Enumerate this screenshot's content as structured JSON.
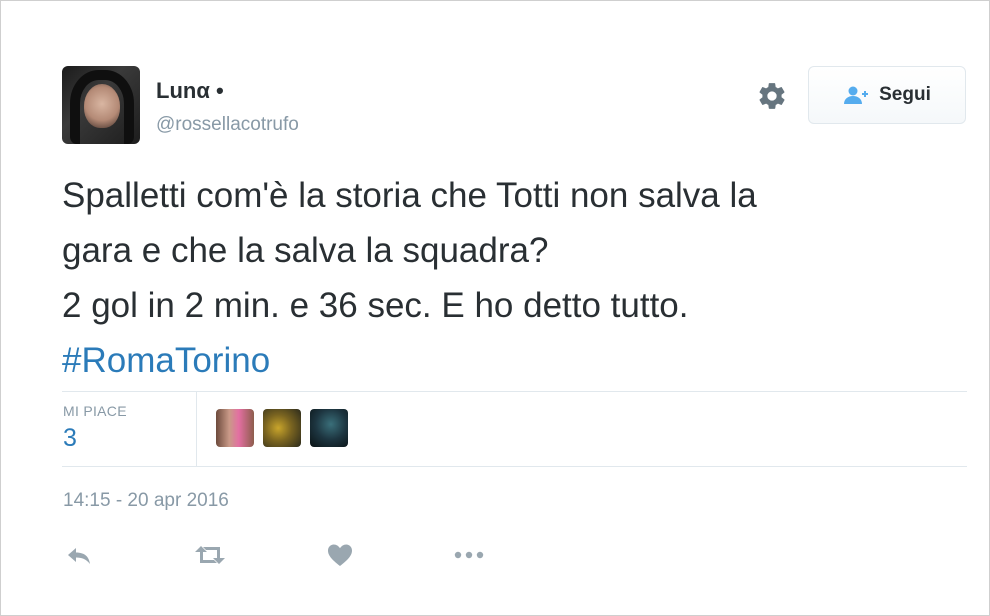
{
  "user": {
    "name": "Lunα •",
    "handle": "@rossellacotrufo"
  },
  "header": {
    "follow_label": "Segui",
    "icons": [
      "gear-icon",
      "follow-user-icon"
    ]
  },
  "tweet": {
    "lines": [
      "Spalletti com'è la storia che Totti non salva la",
      "gara e che la salva la squadra?",
      "2 gol in 2 min. e 36 sec. E ho detto tutto."
    ],
    "hashtag": "#RomaTorino"
  },
  "stats": {
    "likes_label": "MI PIACE",
    "likes_count": "3"
  },
  "timestamp": "14:15 - 20 apr 2016",
  "actions": [
    "reply-icon",
    "retweet-icon",
    "like-icon",
    "more-icon"
  ],
  "colors": {
    "link": "#2b7bb9",
    "muted": "#8899a6",
    "text": "#292f33",
    "accent": "#55acee"
  }
}
